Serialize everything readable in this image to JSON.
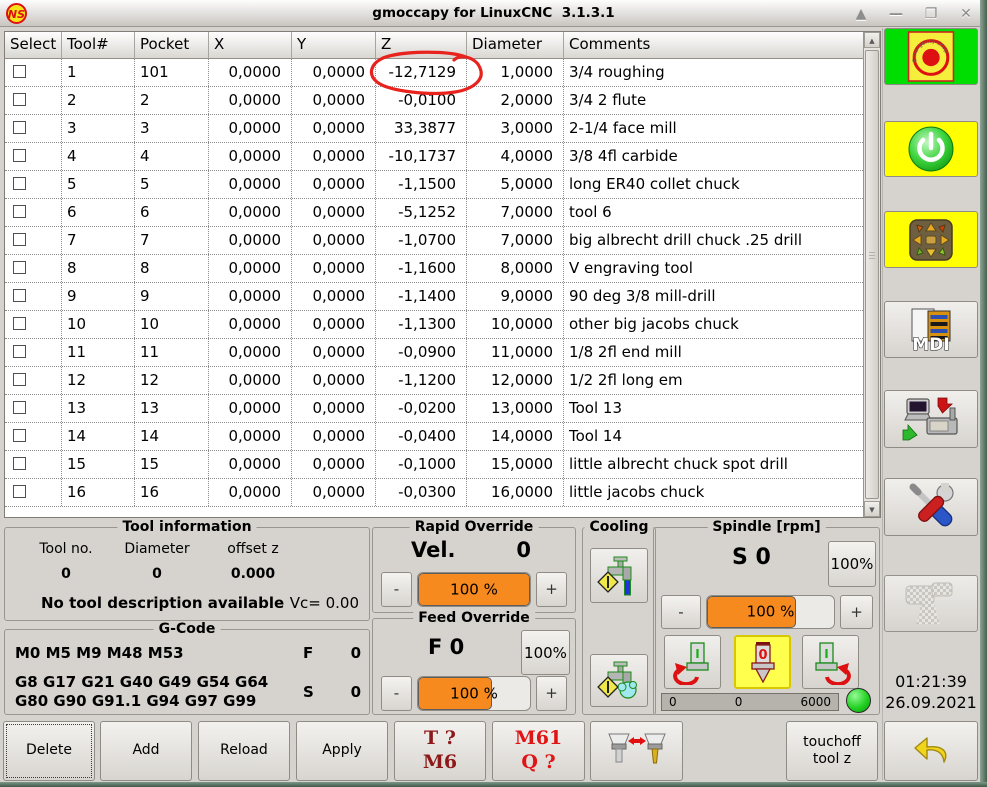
{
  "window": {
    "title": "gmoccapy for LinuxCNC  3.1.3.1",
    "logo_text": "NS",
    "controls": {
      "shade": "▲",
      "minimize": "—",
      "maximize": "❐",
      "close": "✕"
    }
  },
  "table": {
    "columns": [
      "Select",
      "Tool#",
      "Pocket",
      "X",
      "Y",
      "Z",
      "Diameter",
      "Comments"
    ],
    "rows": [
      [
        "1",
        "101",
        "0,0000",
        "0,0000",
        "-12,7129",
        "1,0000",
        "3/4 roughing"
      ],
      [
        "2",
        "2",
        "0,0000",
        "0,0000",
        "-0,0100",
        "2,0000",
        "3/4 2 flute"
      ],
      [
        "3",
        "3",
        "0,0000",
        "0,0000",
        "33,3877",
        "3,0000",
        "2-1/4 face mill"
      ],
      [
        "4",
        "4",
        "0,0000",
        "0,0000",
        "-10,1737",
        "4,0000",
        "3/8 4fl carbide"
      ],
      [
        "5",
        "5",
        "0,0000",
        "0,0000",
        "-1,1500",
        "5,0000",
        "long ER40 collet chuck"
      ],
      [
        "6",
        "6",
        "0,0000",
        "0,0000",
        "-5,1252",
        "7,0000",
        "tool 6"
      ],
      [
        "7",
        "7",
        "0,0000",
        "0,0000",
        "-1,0700",
        "7,0000",
        "big albrecht drill chuck .25 drill"
      ],
      [
        "8",
        "8",
        "0,0000",
        "0,0000",
        "-1,1600",
        "8,0000",
        "V engraving tool"
      ],
      [
        "9",
        "9",
        "0,0000",
        "0,0000",
        "-1,1400",
        "9,0000",
        "90 deg 3/8 mill-drill"
      ],
      [
        "10",
        "10",
        "0,0000",
        "0,0000",
        "-1,1300",
        "10,0000",
        "other big jacobs chuck"
      ],
      [
        "11",
        "11",
        "0,0000",
        "0,0000",
        "-0,0900",
        "11,0000",
        "1/8 2fl end mill"
      ],
      [
        "12",
        "12",
        "0,0000",
        "0,0000",
        "-1,1200",
        "12,0000",
        "1/2 2fl long em"
      ],
      [
        "13",
        "13",
        "0,0000",
        "0,0000",
        "-0,0200",
        "13,0000",
        "Tool 13"
      ],
      [
        "14",
        "14",
        "0,0000",
        "0,0000",
        "-0,0400",
        "14,0000",
        "Tool 14"
      ],
      [
        "15",
        "15",
        "0,0000",
        "0,0000",
        "-0,1000",
        "15,0000",
        "little albrecht chuck spot drill"
      ],
      [
        "16",
        "16",
        "0,0000",
        "0,0000",
        "-0,0300",
        "16,0000",
        "little jacobs chuck"
      ]
    ],
    "highlight": {
      "shape": "hand-drawn ellipse",
      "color": "#e8231d",
      "row": 1,
      "column": "Z",
      "value": "-12,7129"
    }
  },
  "tool_info": {
    "frame_label": "Tool information",
    "tool_no_label": "Tool no.",
    "diameter_label": "Diameter",
    "offset_z_label": "offset z",
    "tool_no_value": "0",
    "diameter_value": "0",
    "offset_z_value": "0.000",
    "description": "No tool description available",
    "vc": "Vc= 0.00"
  },
  "gcode": {
    "frame_label": "G-Code",
    "m_codes": "M0 M5 M9 M48 M53",
    "g_codes": "G8 G17 G21 G40 G49 G54 G64 G80 G90 G91.1 G94 G97 G99",
    "f_label": "F",
    "f_value": "0",
    "s_label": "S",
    "s_value": "0"
  },
  "rapid_override": {
    "frame_label": "Rapid Override",
    "vel_label": "Vel.",
    "vel_value": "0",
    "minus": "-",
    "plus": "+",
    "bar_text": "100 %",
    "fill_pct": 100
  },
  "feed_override": {
    "frame_label": "Feed Override",
    "f_label": "F 0",
    "reset_button": "100%",
    "minus": "-",
    "plus": "+",
    "bar_text": "100 %",
    "fill_pct": 66
  },
  "cooling": {
    "frame_label": "Cooling"
  },
  "spindle": {
    "frame_label": "Spindle [rpm]",
    "s_label": "S 0",
    "reset_button": "100%",
    "minus": "-",
    "plus": "+",
    "bar_text": "100 %",
    "fill_pct": 70,
    "stop_value": "0",
    "run_glyph": "I",
    "scale_min": "0",
    "scale_mid": "0",
    "scale_max": "6000"
  },
  "bottom_bar": {
    "delete": "Delete",
    "add": "Add",
    "reload": "Reload",
    "apply": "Apply",
    "t_line1": "T ?",
    "t_line2": "M6",
    "m61_line1": "M61",
    "m61_line2": "Q ?",
    "touchoff_line1": "touchoff",
    "touchoff_line2": "tool z"
  },
  "sidebar": {
    "estop_text": "Emergency-Stop",
    "mdi_label": "MDI",
    "clock_time": "01:21:39",
    "clock_date": "26.09.2021"
  },
  "colors": {
    "accent_orange": "#f68a1e",
    "estop_green": "#00dd00",
    "active_yellow": "#ffff00",
    "annotation_red": "#e8231d",
    "led_green": "#22d122"
  }
}
